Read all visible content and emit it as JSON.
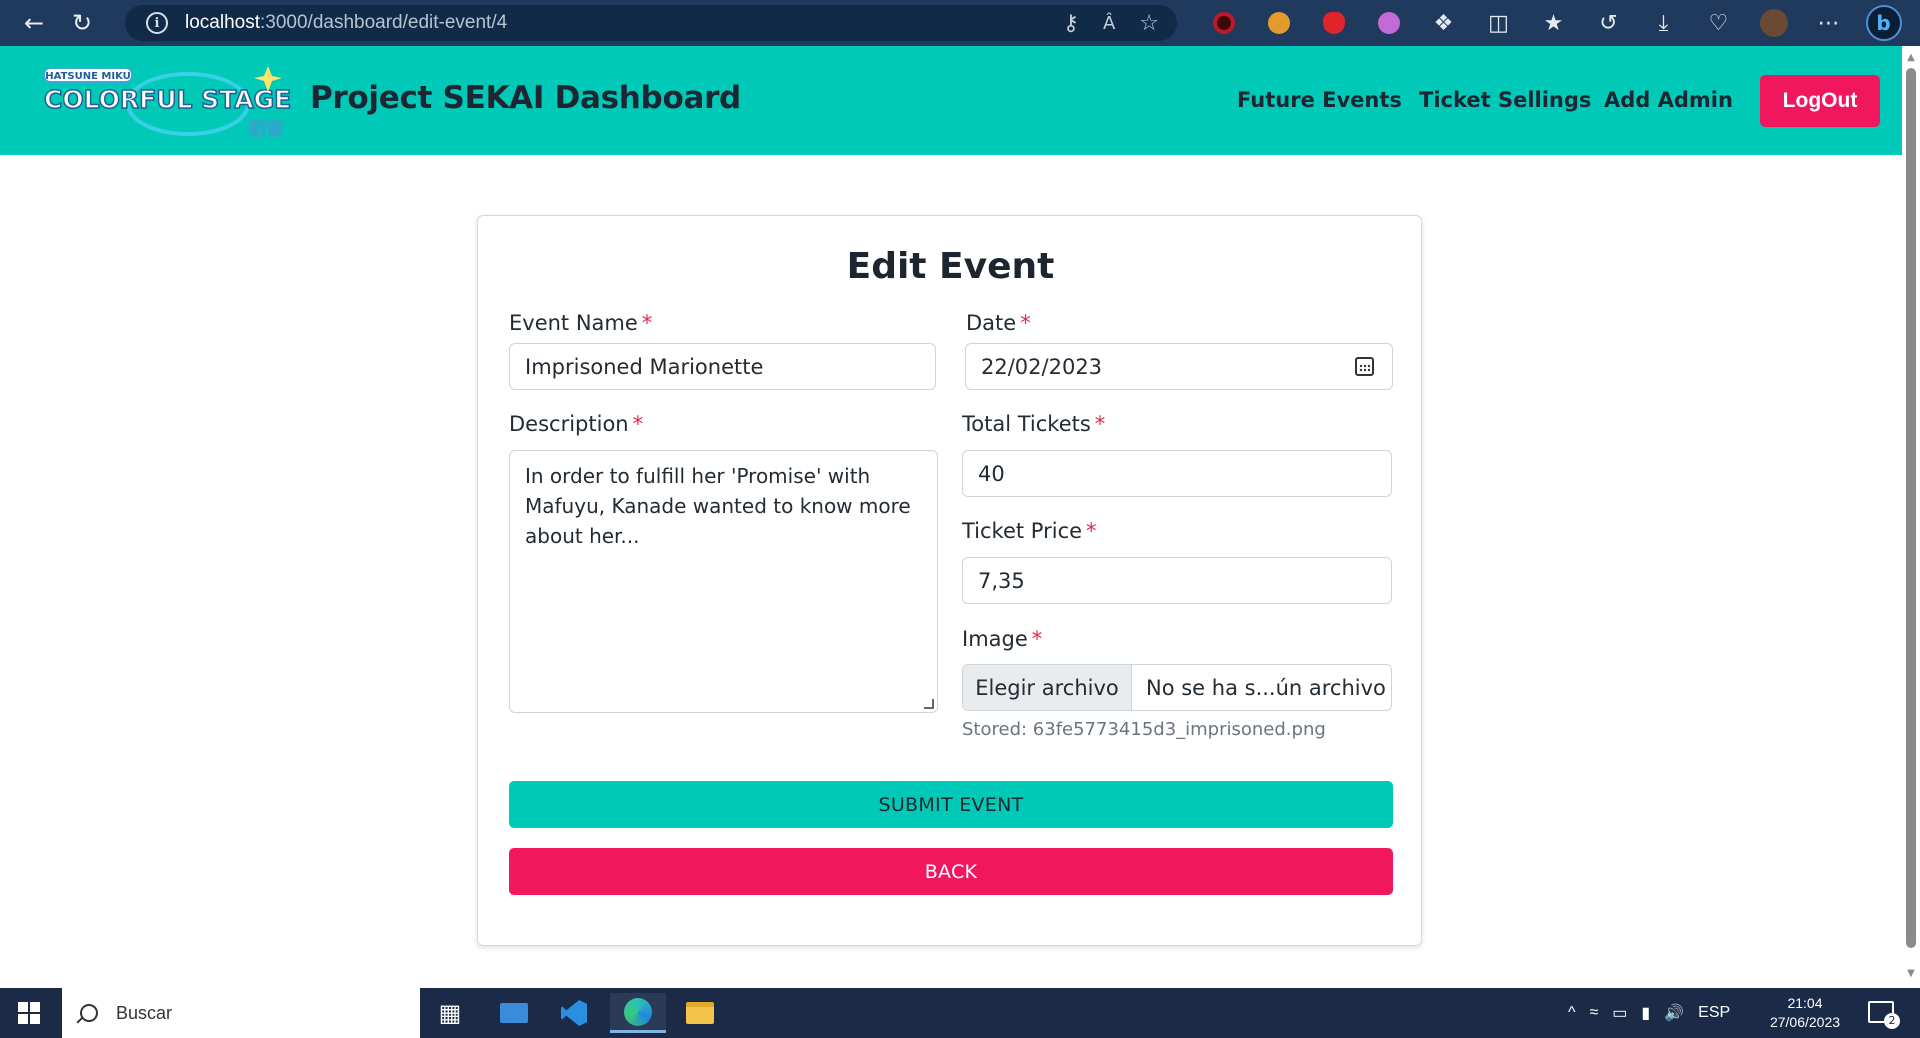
{
  "browser": {
    "url_host": "localhost",
    "url_path": ":3000/dashboard/edit-event/4"
  },
  "header": {
    "logo_alt": "HATSUNE MIKU COLORFUL STAGE!",
    "title": "Project SEKAI Dashboard",
    "nav": [
      "Future Events",
      "Ticket Sellings",
      "Add Admin"
    ],
    "logout_label": "LogOut"
  },
  "form": {
    "title": "Edit Event",
    "required_mark": "*",
    "event_name_label": "Event Name",
    "event_name_value": "Imprisoned Marionette",
    "date_label": "Date",
    "date_value": "22/02/2023",
    "description_label": "Description",
    "description_value": "In order to fulfill her 'Promise' with Mafuyu, Kanade wanted to know more about her...",
    "total_tickets_label": "Total Tickets",
    "total_tickets_value": "40",
    "ticket_price_label": "Ticket Price",
    "ticket_price_value": "7,35",
    "image_label": "Image",
    "file_button_label": "Elegir archivo",
    "file_name_text": "No se ha s...ún archivo",
    "stored_text": "Stored: 63fe5773415d3_imprisoned.png",
    "submit_label": "SUBMIT EVENT",
    "back_label": "BACK"
  },
  "taskbar": {
    "search_placeholder": "Buscar",
    "language": "ESP",
    "time": "21:04",
    "date": "27/06/2023",
    "notification_count": "2"
  },
  "colors": {
    "accent_teal": "#00c9b7",
    "accent_pink": "#f0175e",
    "browser_bar": "#1f3a5c",
    "taskbar": "#1b2b47"
  }
}
